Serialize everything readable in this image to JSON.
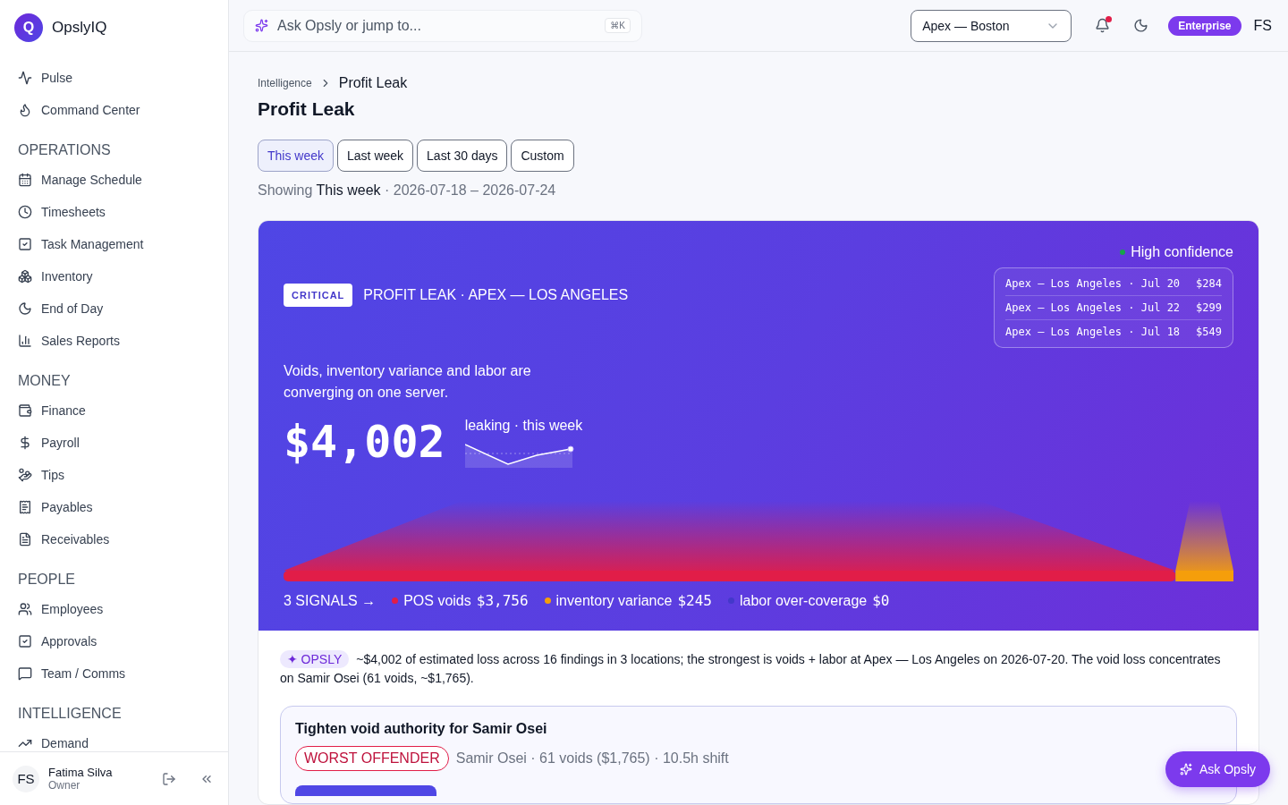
{
  "brand": {
    "logo": "Q",
    "name": "OpslyIQ"
  },
  "sidebar": {
    "top_items": [
      "Pulse",
      "Command Center"
    ],
    "sections": [
      {
        "title": "OPERATIONS",
        "items": [
          "Manage Schedule",
          "Timesheets",
          "Task Management",
          "Inventory",
          "End of Day",
          "Sales Reports"
        ]
      },
      {
        "title": "MONEY",
        "items": [
          "Finance",
          "Payroll",
          "Tips",
          "Payables",
          "Receivables"
        ]
      },
      {
        "title": "PEOPLE",
        "items": [
          "Employees",
          "Approvals",
          "Team / Comms"
        ]
      },
      {
        "title": "INTELLIGENCE",
        "items": [
          "Demand"
        ]
      }
    ],
    "user": {
      "initials": "FS",
      "name": "Fatima Silva",
      "role": "Owner"
    }
  },
  "topbar": {
    "search_placeholder": "Ask Opsly or jump to...",
    "shortcut": "⌘K",
    "location": "Apex — Boston",
    "notification_dot": true,
    "plan": "Enterprise",
    "initials": "FS"
  },
  "breadcrumb": [
    "Intelligence",
    "Profit Leak"
  ],
  "title": "Profit Leak",
  "ranges": [
    {
      "label": "This week",
      "selected": true
    },
    {
      "label": "Last week",
      "selected": false
    },
    {
      "label": "Last 30 days",
      "selected": false
    },
    {
      "label": "Custom",
      "selected": false
    }
  ],
  "showing": {
    "prefix": "Showing",
    "range": "This week",
    "dates": "· 2026-07-18 – 2026-07-24"
  },
  "hero": {
    "severity": "CRITICAL",
    "headline": "PROFIT LEAK · APEX — LOS ANGELES",
    "confidence": {
      "text": "High confidence",
      "color": "#16a34a"
    },
    "top_days": [
      {
        "label": "Apex — Los Angeles · Jul 20",
        "amount": "$284"
      },
      {
        "label": "Apex — Los Angeles · Jul 22",
        "amount": "$299"
      },
      {
        "label": "Apex — Los Angeles · Jul 18",
        "amount": "$549"
      }
    ],
    "summary": "Voids, inventory variance and labor are converging on one server.",
    "amount": "$4,002",
    "trend_label": "leaking · this week",
    "signals_link": "3 SIGNALS →",
    "signals": [
      {
        "label": "POS voids",
        "value": "$3,756",
        "color": "#e11d48",
        "level": 0.939
      },
      {
        "label": "inventory variance",
        "value": "$245",
        "color": "#f59e0b",
        "level": 0.061
      },
      {
        "label": "labor over-coverage",
        "value": "$0",
        "color": "#4338ca",
        "level": 0
      }
    ]
  },
  "insight": {
    "tag": "✦ OPSLY",
    "text": "~$4,002 of estimated loss across 16 findings in 3 locations; the strongest is voids + labor at Apex — Los Angeles on 2026-07-20. The void loss concentrates on Samir Osei (61 voids, ~$1,765)."
  },
  "action": {
    "title": "Tighten void authority for Samir Osei",
    "badge": "WORST OFFENDER",
    "detail": "Samir Osei · 61 voids ($1,765) · 10.5h shift"
  },
  "fab": "Ask Opsly"
}
